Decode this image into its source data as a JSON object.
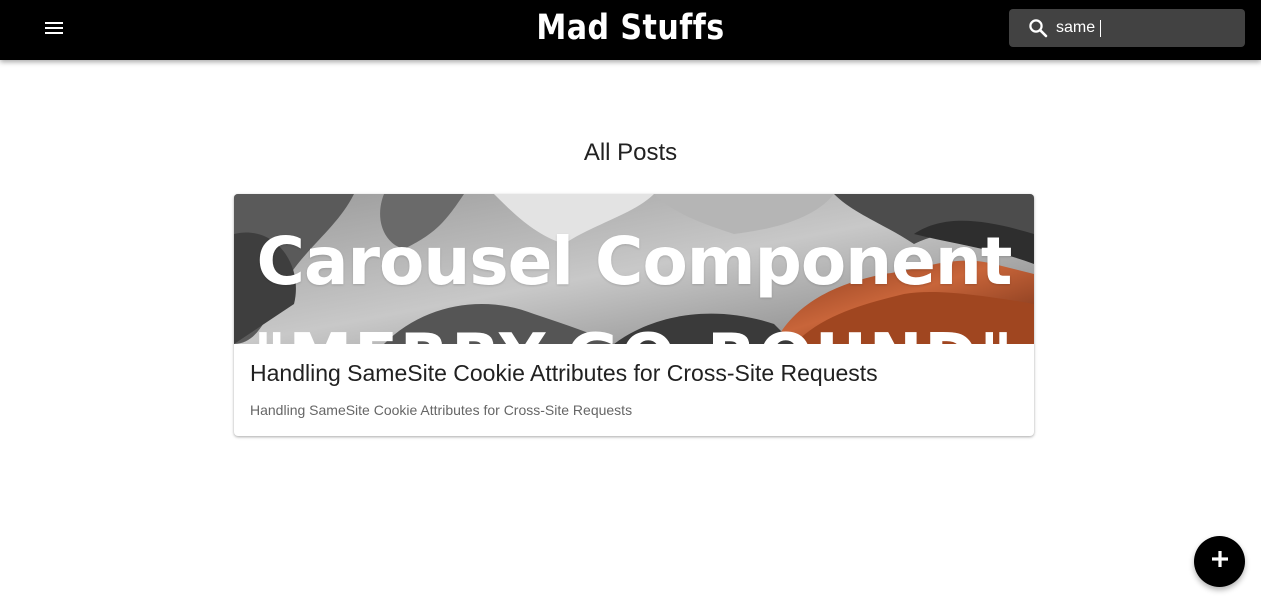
{
  "appbar": {
    "title": "Mad Stuffs",
    "menu_icon": "menu-icon",
    "background": "#000000"
  },
  "search": {
    "icon": "search-icon",
    "value": "same",
    "background": "#424242"
  },
  "main": {
    "heading": "All Posts",
    "posts": [
      {
        "image_title": "Carousel Component",
        "image_subtitle": "\"MERRY-GO-ROUND\"",
        "title": "Handling SameSite Cookie Attributes for Cross-Site Requests",
        "description": "Handling SameSite Cookie Attributes for Cross-Site Requests"
      }
    ]
  },
  "fab": {
    "icon": "plus-icon",
    "background": "#000000"
  }
}
